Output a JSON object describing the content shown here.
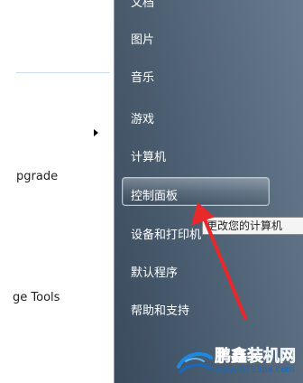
{
  "left_panel": {
    "item_upgrade": "pgrade",
    "item_tools": "ge Tools"
  },
  "start_menu": {
    "items": [
      {
        "label": "文档"
      },
      {
        "label": "图片"
      },
      {
        "label": "音乐"
      },
      {
        "label": "游戏"
      },
      {
        "label": "计算机"
      },
      {
        "label": "控制面板"
      },
      {
        "label": "设备和打印机"
      },
      {
        "label": "默认程序"
      },
      {
        "label": "帮助和支持"
      }
    ],
    "highlighted": "控制面板"
  },
  "tooltip": {
    "text": "更改您的计算机"
  },
  "annotation": {
    "arrow_color": "#e8282a"
  },
  "watermark": {
    "name": "鹏鑫装机网",
    "url": "www.0753px.com"
  },
  "colors": {
    "menu_bg": "#4b6074",
    "brand_blue": "#1769c2"
  }
}
